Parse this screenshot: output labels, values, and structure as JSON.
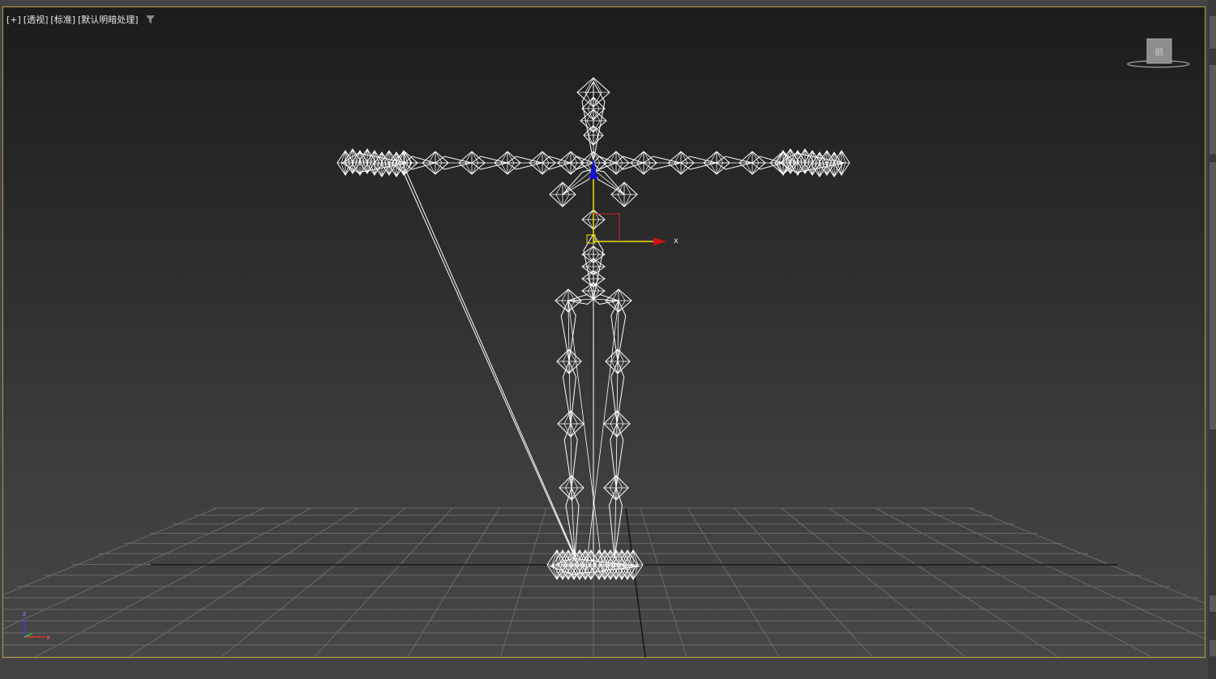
{
  "viewport": {
    "plus_label": "[+]",
    "view_label": "[透视]",
    "shading_label": "[标准]",
    "lighting_label": "[默认明暗处理]",
    "filter_icon": "filter-icon",
    "border_color": "#b89b3a",
    "gizmo": {
      "x_label": "x"
    },
    "tripod": {
      "z_label": "z",
      "x_label": "x"
    },
    "viewcube": {
      "face_label": "前"
    }
  },
  "colors": {
    "wire": "#ffffff",
    "grid": "#6a6a6a",
    "axis_x": "#ff2a2a",
    "axis_y": "#2adf2a",
    "axis_z": "#2a2aff",
    "gizmo_yellow": "#f0e000"
  }
}
